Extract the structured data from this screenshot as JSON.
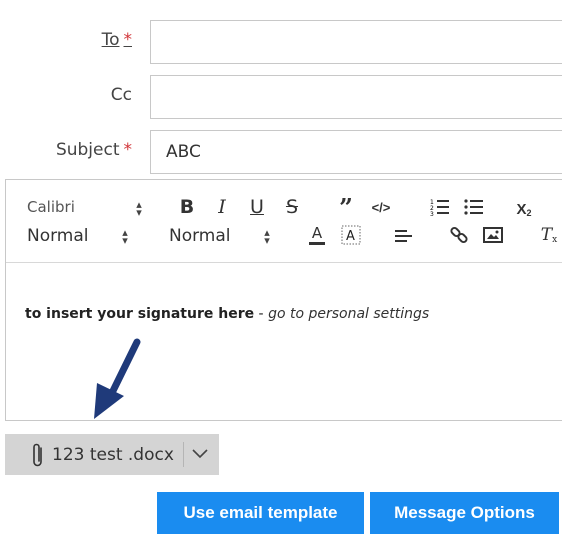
{
  "fields": {
    "to": {
      "label": "To",
      "required_mark": "*",
      "value": ""
    },
    "cc": {
      "label": "Cc",
      "value": ""
    },
    "subject": {
      "label": "Subject",
      "required_mark": "*",
      "value": "ABC"
    }
  },
  "toolbar": {
    "font_family": "Calibri",
    "paragraph_style": "Normal",
    "font_size": "Normal",
    "icons": [
      "bold",
      "italic",
      "underline",
      "strikethrough",
      "quote",
      "code",
      "ordered-list",
      "bullet-list",
      "subscript",
      "font-color",
      "highlight",
      "align-left",
      "link",
      "image",
      "clear-format"
    ]
  },
  "editor": {
    "signature_bold": "to insert your signature here",
    "signature_sep": " - ",
    "signature_italic": "go to personal settings"
  },
  "attachment": {
    "name": "123 test .docx"
  },
  "buttons": {
    "email_template": "Use email template",
    "message_options": "Message Options"
  },
  "colors": {
    "accent": "#1a8cf0",
    "required": "#d13438",
    "arrow": "#1f3a7a",
    "attachment_bg": "#d4d4d4"
  }
}
